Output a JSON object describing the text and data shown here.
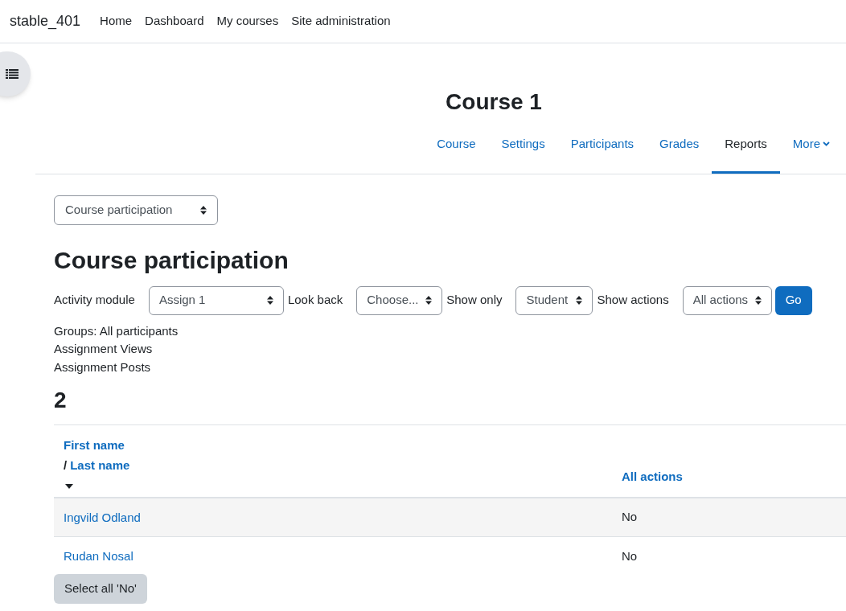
{
  "navbar": {
    "site_name": "stable_401",
    "links": [
      "Home",
      "Dashboard",
      "My courses",
      "Site administration"
    ]
  },
  "course": {
    "title": "Course 1",
    "tabs": [
      {
        "label": "Course",
        "selected": false,
        "kind": "link"
      },
      {
        "label": "Settings",
        "selected": false,
        "kind": "link"
      },
      {
        "label": "Participants",
        "selected": false,
        "kind": "link"
      },
      {
        "label": "Grades",
        "selected": false,
        "kind": "link"
      },
      {
        "label": "Reports",
        "selected": true,
        "kind": "link"
      },
      {
        "label": "More",
        "selected": false,
        "kind": "menu"
      }
    ]
  },
  "report_select": {
    "value": "Course participation"
  },
  "heading": "Course participation",
  "filters": [
    {
      "label": "Activity module",
      "value": "Assign 1"
    },
    {
      "label": "Look back",
      "value": "Choose..."
    },
    {
      "label": "Show only",
      "value": "Student"
    },
    {
      "label": "Show actions",
      "value": "All actions"
    }
  ],
  "go_button": "Go",
  "info_lines": [
    "Groups: All participants",
    "Assignment Views",
    "Assignment Posts"
  ],
  "count": "2",
  "table": {
    "columns": [
      {
        "first": "First name",
        "separator": "/",
        "last": "Last name"
      },
      {
        "label": "All actions"
      }
    ],
    "rows": [
      {
        "name": "Ingvild Odland",
        "value": "No"
      },
      {
        "name": "Rudan Nosal",
        "value": "No"
      }
    ]
  },
  "select_all_button": "Select all 'No'"
}
